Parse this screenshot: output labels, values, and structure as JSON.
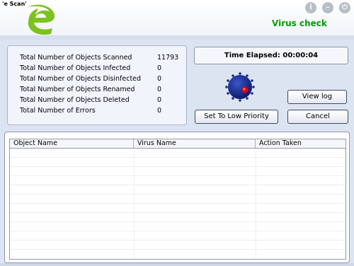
{
  "app": {
    "brand": "'e Scan'",
    "window_title": "Virus check"
  },
  "colors": {
    "title": "#00a000",
    "accent_green": "#7cc21e",
    "globe_blue": "#1a2f8c",
    "globe_dot": "#e00010"
  },
  "window_buttons": [
    "info-icon",
    "minimize-icon",
    "power-icon"
  ],
  "stats": [
    {
      "label": "Total Number of Objects Scanned",
      "value": "11793"
    },
    {
      "label": "Total Number of Objects Infected",
      "value": "0"
    },
    {
      "label": "Total Number of Objects Disinfected",
      "value": "0"
    },
    {
      "label": "Total Number of Objects Renamed",
      "value": "0"
    },
    {
      "label": "Total Number of Objects Deleted",
      "value": "0"
    },
    {
      "label": "Total Number of Errors",
      "value": "0"
    }
  ],
  "timer": {
    "label": "Time Elapsed:",
    "value": "00:00:04"
  },
  "buttons": {
    "view_log": "View log",
    "low_priority": "Set To Low Priority",
    "cancel": "Cancel"
  },
  "table": {
    "columns": [
      "Object Name",
      "Virus Name",
      "Action Taken"
    ],
    "rows": []
  }
}
